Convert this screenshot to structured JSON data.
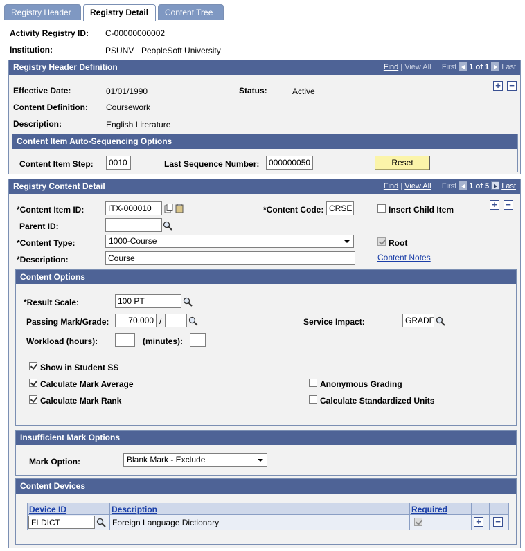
{
  "tabs": [
    "Registry Header",
    "Registry Detail",
    "Content Tree"
  ],
  "top": {
    "activity_registry_id_label": "Activity Registry ID:",
    "activity_registry_id": "C-00000000002",
    "institution_label": "Institution:",
    "institution_code": "PSUNV",
    "institution_name": "PeopleSoft University"
  },
  "header_def": {
    "title": "Registry Header Definition",
    "find": "Find",
    "sep": "|",
    "view_all": "View All",
    "first": "First",
    "count": "1 of 1",
    "last": "Last",
    "effective_date_label": "Effective Date:",
    "effective_date": "01/01/1990",
    "status_label": "Status:",
    "status": "Active",
    "content_def_label": "Content Definition:",
    "content_def": "Coursework",
    "description_label": "Description:",
    "description": "English Literature"
  },
  "auto_seq": {
    "title": "Content Item Auto-Sequencing Options",
    "step_label": "Content Item Step:",
    "step": "0010",
    "last_seq_label": "Last Sequence Number:",
    "last_seq": "000000050",
    "reset": "Reset"
  },
  "content_detail": {
    "title": "Registry Content Detail",
    "find": "Find",
    "sep": "|",
    "view_all": "View All",
    "first": "First",
    "count": "1 of 5",
    "last": "Last",
    "item_id_label": "*Content Item ID:",
    "item_id": "ITX-000010",
    "code_label": "*Content Code:",
    "code": "CRSE",
    "insert_child": "Insert Child Item",
    "parent_id_label": "Parent ID:",
    "parent_id": "",
    "type_label": "*Content Type:",
    "type": "1000-Course",
    "root": "Root",
    "desc_label": "*Description:",
    "desc": "Course",
    "notes_link": "Content Notes"
  },
  "content_options": {
    "title": "Content Options",
    "result_scale_label": "*Result Scale:",
    "result_scale": "100 PT",
    "passing_label": "Passing Mark/Grade:",
    "passing_mark": "70.000",
    "slash": "/",
    "passing_grade": "",
    "service_impact_label": "Service Impact:",
    "service_impact": "GRADE",
    "workload_label": "Workload (hours):",
    "minutes_label": "(minutes):",
    "show_student": "Show in Student SS",
    "calc_avg": "Calculate Mark Average",
    "calc_rank": "Calculate Mark Rank",
    "anon_grading": "Anonymous Grading",
    "calc_std_units": "Calculate Standardized Units"
  },
  "insufficient": {
    "title": "Insufficient Mark Options",
    "mark_option_label": "Mark Option:",
    "mark_option": "Blank Mark - Exclude"
  },
  "devices": {
    "title": "Content Devices",
    "col_device": "Device ID",
    "col_desc": "Description",
    "col_required": "Required",
    "row_device": "FLDICT",
    "row_desc": "Foreign Language Dictionary"
  }
}
